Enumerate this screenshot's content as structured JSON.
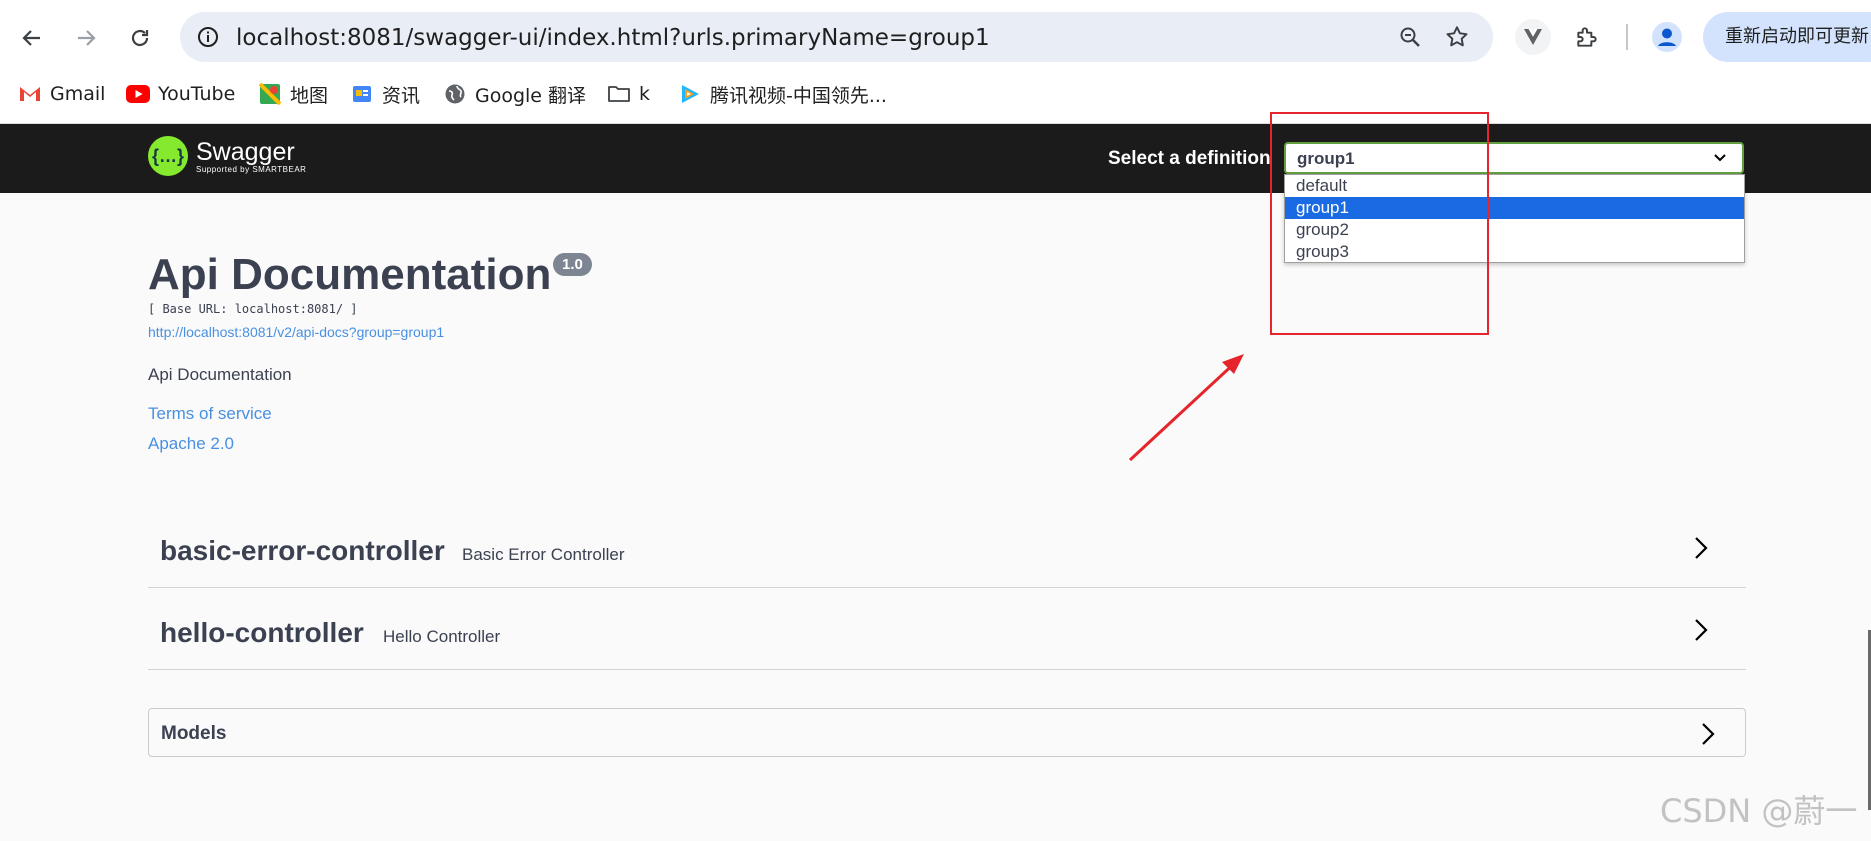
{
  "browser": {
    "url": "localhost:8081/swagger-ui/index.html?urls.primaryName=group1",
    "restart_label": "重新启动即可更新",
    "bookmarks": [
      {
        "label": "Gmail"
      },
      {
        "label": "YouTube"
      },
      {
        "label": "地图"
      },
      {
        "label": "资讯"
      },
      {
        "label": "Google 翻译"
      },
      {
        "label": "k"
      },
      {
        "label": "腾讯视频-中国领先..."
      }
    ]
  },
  "swagger": {
    "logo_name": "Swagger",
    "logo_sub": "Supported by SMARTBEAR",
    "select_label": "Select a definition",
    "selected_definition": "group1",
    "definitions": [
      "default",
      "group1",
      "group2",
      "group3"
    ],
    "title": "Api Documentation",
    "version": "1.0",
    "base_url": "[ Base URL: localhost:8081/ ]",
    "spec_url": "http://localhost:8081/v2/api-docs?group=group1",
    "description": "Api Documentation",
    "terms": "Terms of service",
    "license": "Apache 2.0",
    "controllers": [
      {
        "name": "basic-error-controller",
        "description": "Basic Error Controller"
      },
      {
        "name": "hello-controller",
        "description": "Hello Controller"
      }
    ],
    "models_label": "Models"
  },
  "watermark": "CSDN @蔚一",
  "colors": {
    "accent": "#85ea2d",
    "annotation": "#e5242b",
    "link": "#4990e2",
    "selected_option": "#1a6ae3"
  }
}
